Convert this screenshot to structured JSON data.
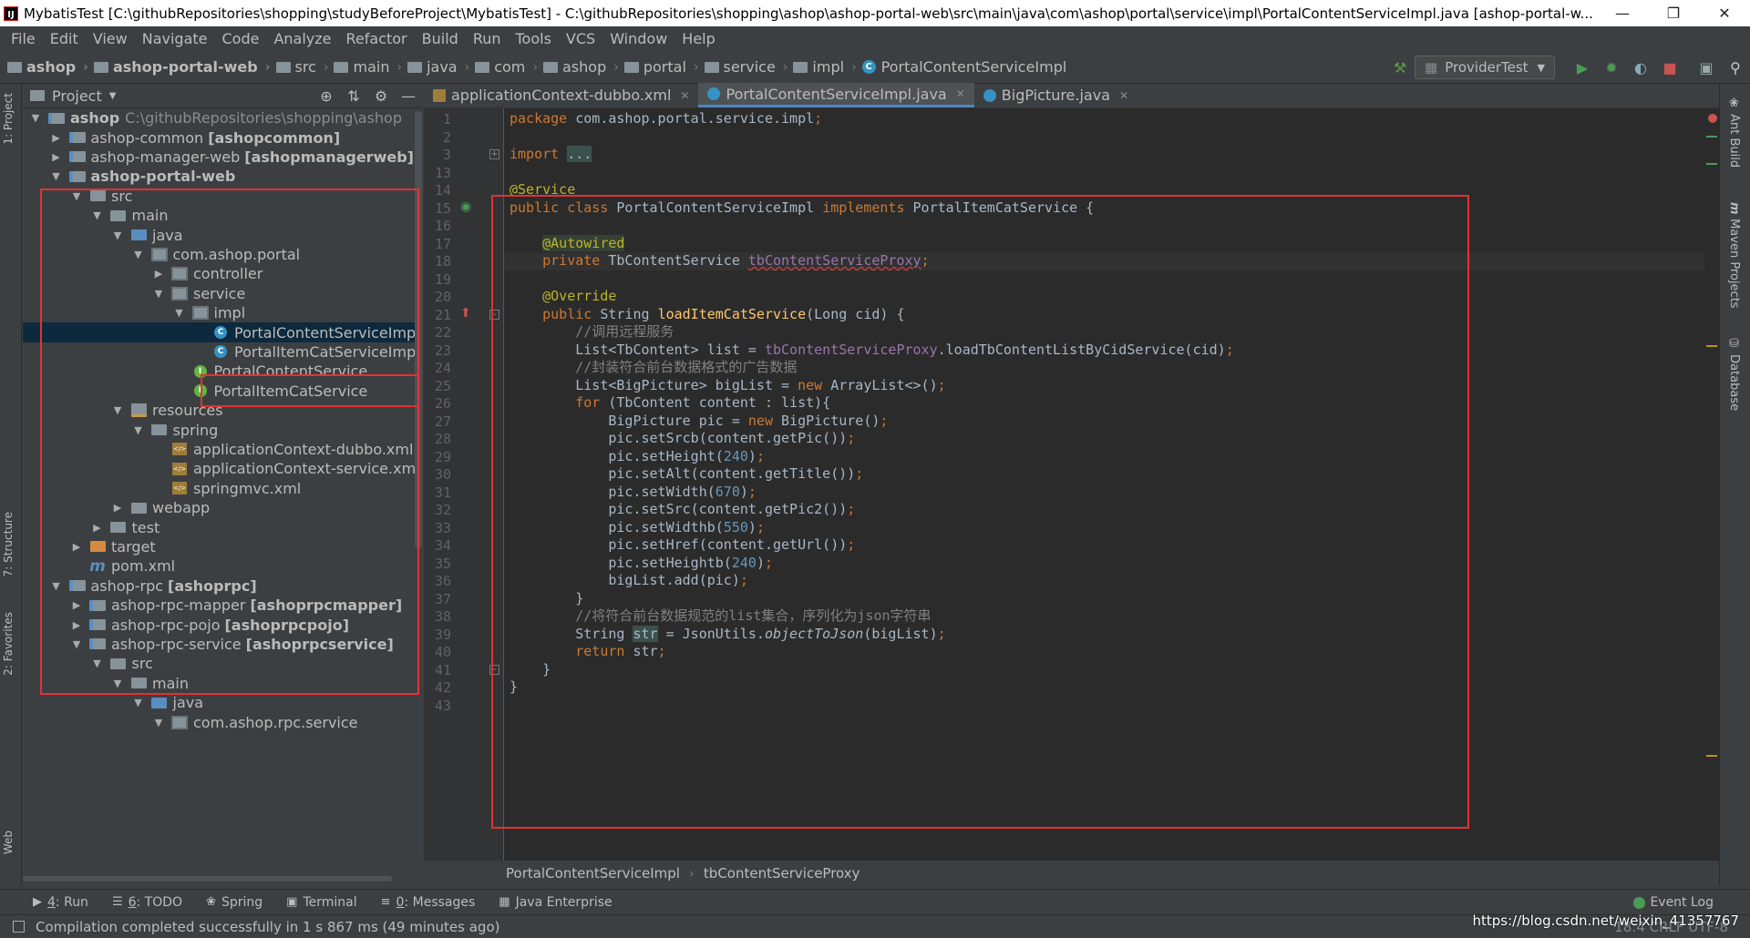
{
  "window": {
    "title": "MybatisTest [C:\\githubRepositories\\shopping\\studyBeforeProject\\MybatisTest] - C:\\githubRepositories\\shopping\\ashop\\ashop-portal-web\\src\\main\\java\\com\\ashop\\portal\\service\\impl\\PortalContentServiceImpl.java [ashop-portal-w...",
    "app_icon": "IJ"
  },
  "menu": [
    "File",
    "Edit",
    "View",
    "Navigate",
    "Code",
    "Analyze",
    "Refactor",
    "Build",
    "Run",
    "Tools",
    "VCS",
    "Window",
    "Help"
  ],
  "breadcrumbs": [
    "ashop",
    "ashop-portal-web",
    "src",
    "main",
    "java",
    "com",
    "ashop",
    "portal",
    "service",
    "impl",
    "PortalContentServiceImpl"
  ],
  "run_config": "ProviderTest",
  "project_panel": {
    "title": "Project",
    "tree": [
      {
        "label": "ashop",
        "extra": "C:\\githubRepositories\\shopping\\ashop",
        "bracket": "",
        "depth": 0,
        "arrow": "▼",
        "icon": "module",
        "bold": true
      },
      {
        "label": "ashop-common",
        "extra": "",
        "bracket": "[ashopcommon]",
        "depth": 1,
        "arrow": "▶",
        "icon": "module"
      },
      {
        "label": "ashop-manager-web",
        "extra": "",
        "bracket": "[ashopmanagerweb]",
        "depth": 1,
        "arrow": "▶",
        "icon": "module"
      },
      {
        "label": "ashop-portal-web",
        "extra": "",
        "bracket": "",
        "depth": 1,
        "arrow": "▼",
        "icon": "module",
        "bold": true
      },
      {
        "label": "src",
        "extra": "",
        "bracket": "",
        "depth": 2,
        "arrow": "▼",
        "icon": "folder"
      },
      {
        "label": "main",
        "extra": "",
        "bracket": "",
        "depth": 3,
        "arrow": "▼",
        "icon": "folder"
      },
      {
        "label": "java",
        "extra": "",
        "bracket": "",
        "depth": 4,
        "arrow": "▼",
        "icon": "srcfolder"
      },
      {
        "label": "com.ashop.portal",
        "extra": "",
        "bracket": "",
        "depth": 5,
        "arrow": "▼",
        "icon": "pkg"
      },
      {
        "label": "controller",
        "extra": "",
        "bracket": "",
        "depth": 6,
        "arrow": "▶",
        "icon": "pkg"
      },
      {
        "label": "service",
        "extra": "",
        "bracket": "",
        "depth": 6,
        "arrow": "▼",
        "icon": "pkg"
      },
      {
        "label": "impl",
        "extra": "",
        "bracket": "",
        "depth": 7,
        "arrow": "▼",
        "icon": "pkg"
      },
      {
        "label": "PortalContentServiceImpl",
        "extra": "",
        "bracket": "",
        "depth": 8,
        "arrow": "",
        "icon": "cls",
        "selected": true
      },
      {
        "label": "PortalItemCatServiceImpl",
        "extra": "",
        "bracket": "",
        "depth": 8,
        "arrow": "",
        "icon": "cls"
      },
      {
        "label": "PortalContentService",
        "extra": "",
        "bracket": "",
        "depth": 7,
        "arrow": "",
        "icon": "intf"
      },
      {
        "label": "PortalItemCatService",
        "extra": "",
        "bracket": "",
        "depth": 7,
        "arrow": "",
        "icon": "intf"
      },
      {
        "label": "resources",
        "extra": "",
        "bracket": "",
        "depth": 4,
        "arrow": "▼",
        "icon": "resfolder"
      },
      {
        "label": "spring",
        "extra": "",
        "bracket": "",
        "depth": 5,
        "arrow": "▼",
        "icon": "folder"
      },
      {
        "label": "applicationContext-dubbo.xml",
        "extra": "",
        "bracket": "",
        "depth": 6,
        "arrow": "",
        "icon": "xml"
      },
      {
        "label": "applicationContext-service.xml",
        "extra": "",
        "bracket": "",
        "depth": 6,
        "arrow": "",
        "icon": "xml"
      },
      {
        "label": "springmvc.xml",
        "extra": "",
        "bracket": "",
        "depth": 6,
        "arrow": "",
        "icon": "xml"
      },
      {
        "label": "webapp",
        "extra": "",
        "bracket": "",
        "depth": 4,
        "arrow": "▶",
        "icon": "folder"
      },
      {
        "label": "test",
        "extra": "",
        "bracket": "",
        "depth": 3,
        "arrow": "▶",
        "icon": "folder"
      },
      {
        "label": "target",
        "extra": "",
        "bracket": "",
        "depth": 2,
        "arrow": "▶",
        "icon": "orange"
      },
      {
        "label": "pom.xml",
        "extra": "",
        "bracket": "",
        "depth": 2,
        "arrow": "",
        "icon": "maven"
      },
      {
        "label": "ashop-rpc",
        "extra": "",
        "bracket": "[ashoprpc]",
        "depth": 1,
        "arrow": "▼",
        "icon": "module"
      },
      {
        "label": "ashop-rpc-mapper",
        "extra": "",
        "bracket": "[ashoprpcmapper]",
        "depth": 2,
        "arrow": "▶",
        "icon": "module"
      },
      {
        "label": "ashop-rpc-pojo",
        "extra": "",
        "bracket": "[ashoprpcpojo]",
        "depth": 2,
        "arrow": "▶",
        "icon": "module"
      },
      {
        "label": "ashop-rpc-service",
        "extra": "",
        "bracket": "[ashoprpcservice]",
        "depth": 2,
        "arrow": "▼",
        "icon": "module"
      },
      {
        "label": "src",
        "extra": "",
        "bracket": "",
        "depth": 3,
        "arrow": "▼",
        "icon": "folder"
      },
      {
        "label": "main",
        "extra": "",
        "bracket": "",
        "depth": 4,
        "arrow": "▼",
        "icon": "folder"
      },
      {
        "label": "java",
        "extra": "",
        "bracket": "",
        "depth": 5,
        "arrow": "▼",
        "icon": "srcfolder"
      },
      {
        "label": "com.ashop.rpc.service",
        "extra": "",
        "bracket": "",
        "depth": 6,
        "arrow": "▼",
        "icon": "pkg"
      }
    ]
  },
  "left_strip": [
    "1: Project",
    "7: Structure",
    "2: Favorites",
    "Web"
  ],
  "right_strip": [
    "Ant Build",
    "Maven Projects",
    "Database"
  ],
  "editor": {
    "tabs": [
      {
        "label": "applicationContext-dubbo.xml",
        "icon": "xml",
        "active": false
      },
      {
        "label": "PortalContentServiceImpl.java",
        "icon": "cls",
        "active": true
      },
      {
        "label": "BigPicture.java",
        "icon": "cls",
        "active": false
      }
    ],
    "lines": [
      {
        "n": "1",
        "html": "<span class=\"kw\">package </span>com.ashop.portal.service.impl<span class=\"kw\">;</span>"
      },
      {
        "n": "2",
        "html": ""
      },
      {
        "n": "3",
        "html": "<span class=\"kw\">import </span><span class=\"foldbox\">...</span>",
        "fold": "+"
      },
      {
        "n": "13",
        "html": ""
      },
      {
        "n": "14",
        "html": "<span class=\"ann\">@Service</span>"
      },
      {
        "n": "15",
        "html": "<span class=\"kw\">public class </span>PortalContentServiceImpl <span class=\"kw\">implements </span>PortalItemCatService {",
        "mark": "impl"
      },
      {
        "n": "16",
        "html": ""
      },
      {
        "n": "17",
        "html": "    <span class=\"annhl\">@Autowired</span>"
      },
      {
        "n": "18",
        "html": "    <span class=\"kw\">private </span>TbContentService <span class=\"fldu\">tbContentServiceProxy</span><span class=\"kw\">;</span>",
        "cur": true
      },
      {
        "n": "19",
        "html": ""
      },
      {
        "n": "20",
        "html": "    <span class=\"ann\">@Override</span>"
      },
      {
        "n": "21",
        "html": "    <span class=\"kw\">public </span>String <span class=\"fn\">loadItemCatService</span>(Long cid) {",
        "mark": "override",
        "fold": "-"
      },
      {
        "n": "22",
        "html": "        <span class=\"cmt\">//调用远程服务</span>"
      },
      {
        "n": "23",
        "html": "        List&lt;TbContent&gt; list = <span class=\"fld\">tbContentServiceProxy</span>.loadTbContentListByCidService(cid)<span class=\"kw\">;</span>"
      },
      {
        "n": "24",
        "html": "        <span class=\"cmt\">//封装符合前台数据格式的广告数据</span>"
      },
      {
        "n": "25",
        "html": "        List&lt;BigPicture&gt; bigList = <span class=\"kw\">new </span>ArrayList&lt;&gt;()<span class=\"kw\">;</span>"
      },
      {
        "n": "26",
        "html": "        <span class=\"kw\">for </span>(TbContent content : list){"
      },
      {
        "n": "27",
        "html": "            BigPicture pic = <span class=\"kw\">new </span>BigPicture()<span class=\"kw\">;</span>"
      },
      {
        "n": "28",
        "html": "            pic.setSrcb(content.getPic())<span class=\"kw\">;</span>"
      },
      {
        "n": "29",
        "html": "            pic.setHeight(<span class=\"num\">240</span>)<span class=\"kw\">;</span>"
      },
      {
        "n": "30",
        "html": "            pic.setAlt(content.getTitle())<span class=\"kw\">;</span>"
      },
      {
        "n": "31",
        "html": "            pic.setWidth(<span class=\"num\">670</span>)<span class=\"kw\">;</span>"
      },
      {
        "n": "32",
        "html": "            pic.setSrc(content.getPic2())<span class=\"kw\">;</span>"
      },
      {
        "n": "33",
        "html": "            pic.setWidthb(<span class=\"num\">550</span>)<span class=\"kw\">;</span>"
      },
      {
        "n": "34",
        "html": "            pic.setHref(content.getUrl())<span class=\"kw\">;</span>"
      },
      {
        "n": "35",
        "html": "            pic.setHeightb(<span class=\"num\">240</span>)<span class=\"kw\">;</span>"
      },
      {
        "n": "36",
        "html": "            bigList.add(pic)<span class=\"kw\">;</span>"
      },
      {
        "n": "37",
        "html": "        }"
      },
      {
        "n": "38",
        "html": "        <span class=\"cmt\">//将符合前台数据规范的list集合，序列化为json字符串</span>"
      },
      {
        "n": "39",
        "html": "        String <span class=\"varhl\">str</span> = JsonUtils.<span class=\"it\">objectToJson</span>(bigList)<span class=\"kw\">;</span>"
      },
      {
        "n": "40",
        "html": "        <span class=\"kw\">return </span>str<span class=\"kw\">;</span>"
      },
      {
        "n": "41",
        "html": "    }",
        "fold": "-"
      },
      {
        "n": "42",
        "html": "}"
      },
      {
        "n": "43",
        "html": ""
      }
    ],
    "breadcrumb": [
      "PortalContentServiceImpl",
      "tbContentServiceProxy"
    ]
  },
  "bottom_tools": [
    {
      "icon": "▶",
      "mnemonic": "4",
      "label": ": Run"
    },
    {
      "icon": "☰",
      "mnemonic": "6",
      "label": ": TODO"
    },
    {
      "icon": "❀",
      "mnemonic": "",
      "label": "Spring"
    },
    {
      "icon": "▣",
      "mnemonic": "",
      "label": "Terminal"
    },
    {
      "icon": "≡",
      "mnemonic": "0",
      "label": ": Messages"
    },
    {
      "icon": "▦",
      "mnemonic": "",
      "label": "Java Enterprise"
    }
  ],
  "event_log": "Event Log",
  "status": {
    "message": "Compilation completed successfully in 1 s 867 ms (49 minutes ago)",
    "position": "18:4  CRLF  UTF-8",
    "watermark": "https://blog.csdn.net/weixin_41357767"
  },
  "colors": {
    "highlight_box": "#e23232",
    "editor_bg": "#2b2b2b",
    "panel_bg": "#3c3f41",
    "selection": "#0d293e"
  }
}
